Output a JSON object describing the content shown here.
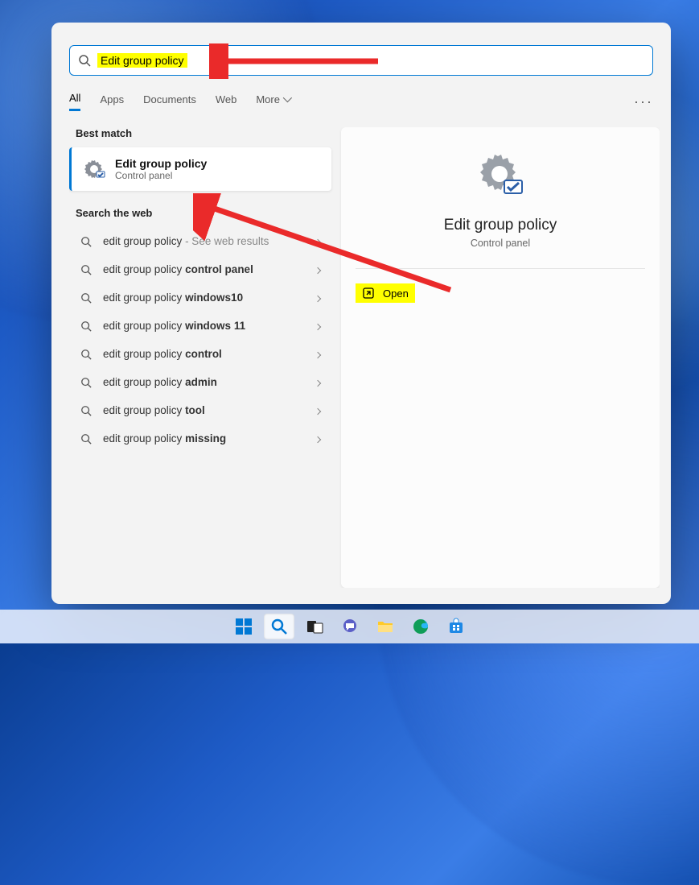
{
  "search": {
    "query": "Edit group policy"
  },
  "tabs": {
    "all": "All",
    "apps": "Apps",
    "documents": "Documents",
    "web": "Web",
    "more": "More"
  },
  "sections": {
    "best_match": "Best match",
    "search_web": "Search the web"
  },
  "best_match": {
    "title": "Edit group policy",
    "subtitle": "Control panel"
  },
  "web_results": [
    {
      "prefix": "edit group policy",
      "suffix": "",
      "hint": " - See web results"
    },
    {
      "prefix": "edit group policy ",
      "suffix": "control panel",
      "hint": ""
    },
    {
      "prefix": "edit group policy ",
      "suffix": "windows10",
      "hint": ""
    },
    {
      "prefix": "edit group policy ",
      "suffix": "windows 11",
      "hint": ""
    },
    {
      "prefix": "edit group policy ",
      "suffix": "control",
      "hint": ""
    },
    {
      "prefix": "edit group policy ",
      "suffix": "admin",
      "hint": ""
    },
    {
      "prefix": "edit group policy ",
      "suffix": "tool",
      "hint": ""
    },
    {
      "prefix": "edit group policy ",
      "suffix": "missing",
      "hint": ""
    }
  ],
  "preview": {
    "title": "Edit group policy",
    "subtitle": "Control panel",
    "open": "Open"
  },
  "taskbar": {
    "items": [
      "start",
      "search",
      "task-view",
      "chat",
      "file-explorer",
      "edge",
      "store"
    ]
  }
}
